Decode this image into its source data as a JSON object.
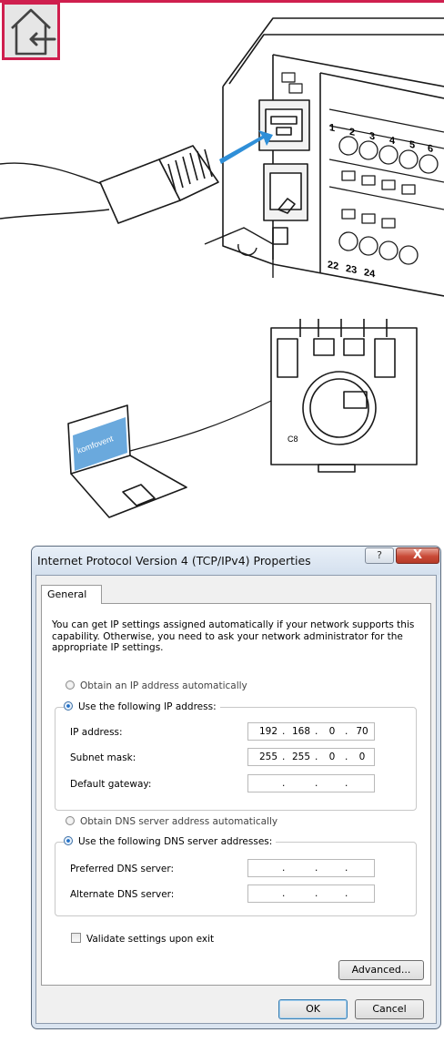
{
  "illustration": {
    "terminal_numbers_top": [
      "1",
      "2",
      "3",
      "4",
      "5",
      "6"
    ],
    "terminal_numbers_bottom": [
      "22",
      "23",
      "24"
    ],
    "laptop_screen_text": "komfovent",
    "controller_label": "C8"
  },
  "dialog": {
    "title": "Internet Protocol Version 4 (TCP/IPv4) Properties",
    "help_glyph": "?",
    "close_glyph": "X",
    "tab_general": "General",
    "intro_text": "You can get IP settings assigned automatically if your network supports this capability. Otherwise, you need to ask your network administrator for the appropriate IP settings.",
    "obtain_ip_auto": "Obtain an IP address automatically",
    "use_following_ip": "Use the following IP address:",
    "ip_label": "IP address:",
    "ip_value": [
      "192",
      "168",
      "0",
      "70"
    ],
    "subnet_label": "Subnet mask:",
    "subnet_value": [
      "255",
      "255",
      "0",
      "0"
    ],
    "gateway_label": "Default gateway:",
    "obtain_dns_auto": "Obtain DNS server address automatically",
    "use_following_dns": "Use the following DNS server addresses:",
    "preferred_dns_label": "Preferred DNS server:",
    "alternate_dns_label": "Alternate DNS server:",
    "dot": ".",
    "validate_label": "Validate settings upon exit",
    "advanced_button": "Advanced...",
    "ok_button": "OK",
    "cancel_button": "Cancel"
  }
}
